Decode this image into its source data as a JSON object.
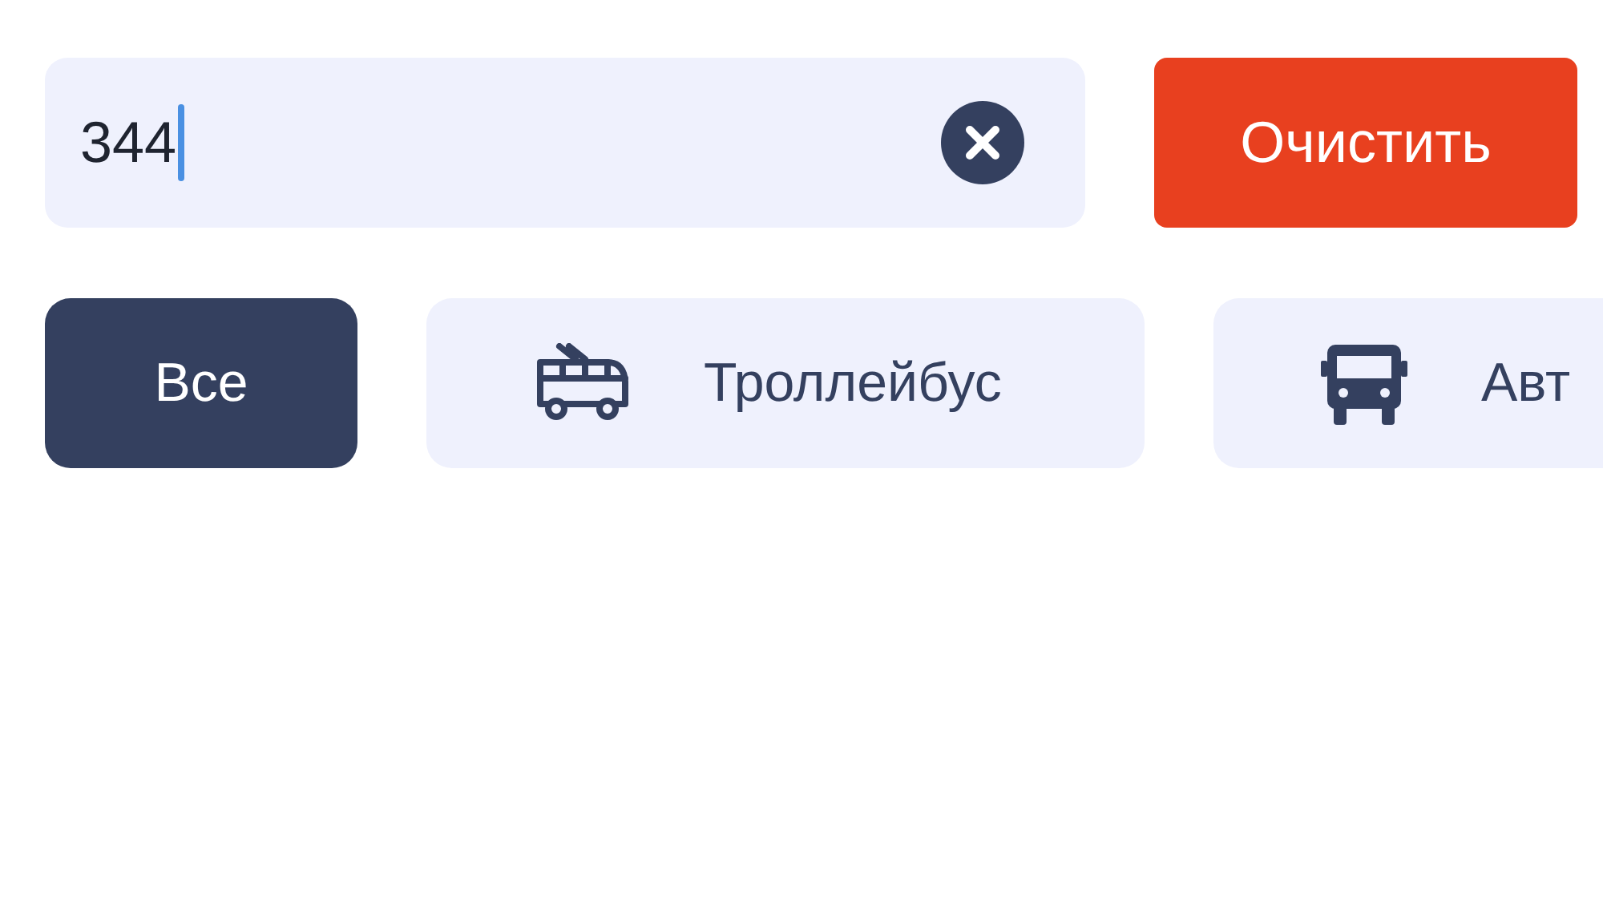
{
  "search": {
    "value": "344",
    "focused": true
  },
  "clear_button": {
    "label": "Очистить"
  },
  "filters": [
    {
      "label": "Все",
      "kind": "text",
      "selected": true
    },
    {
      "label": "Троллейбус",
      "kind": "trolleybus",
      "selected": false
    },
    {
      "label": "Авт",
      "kind": "bus",
      "selected": false
    }
  ]
}
